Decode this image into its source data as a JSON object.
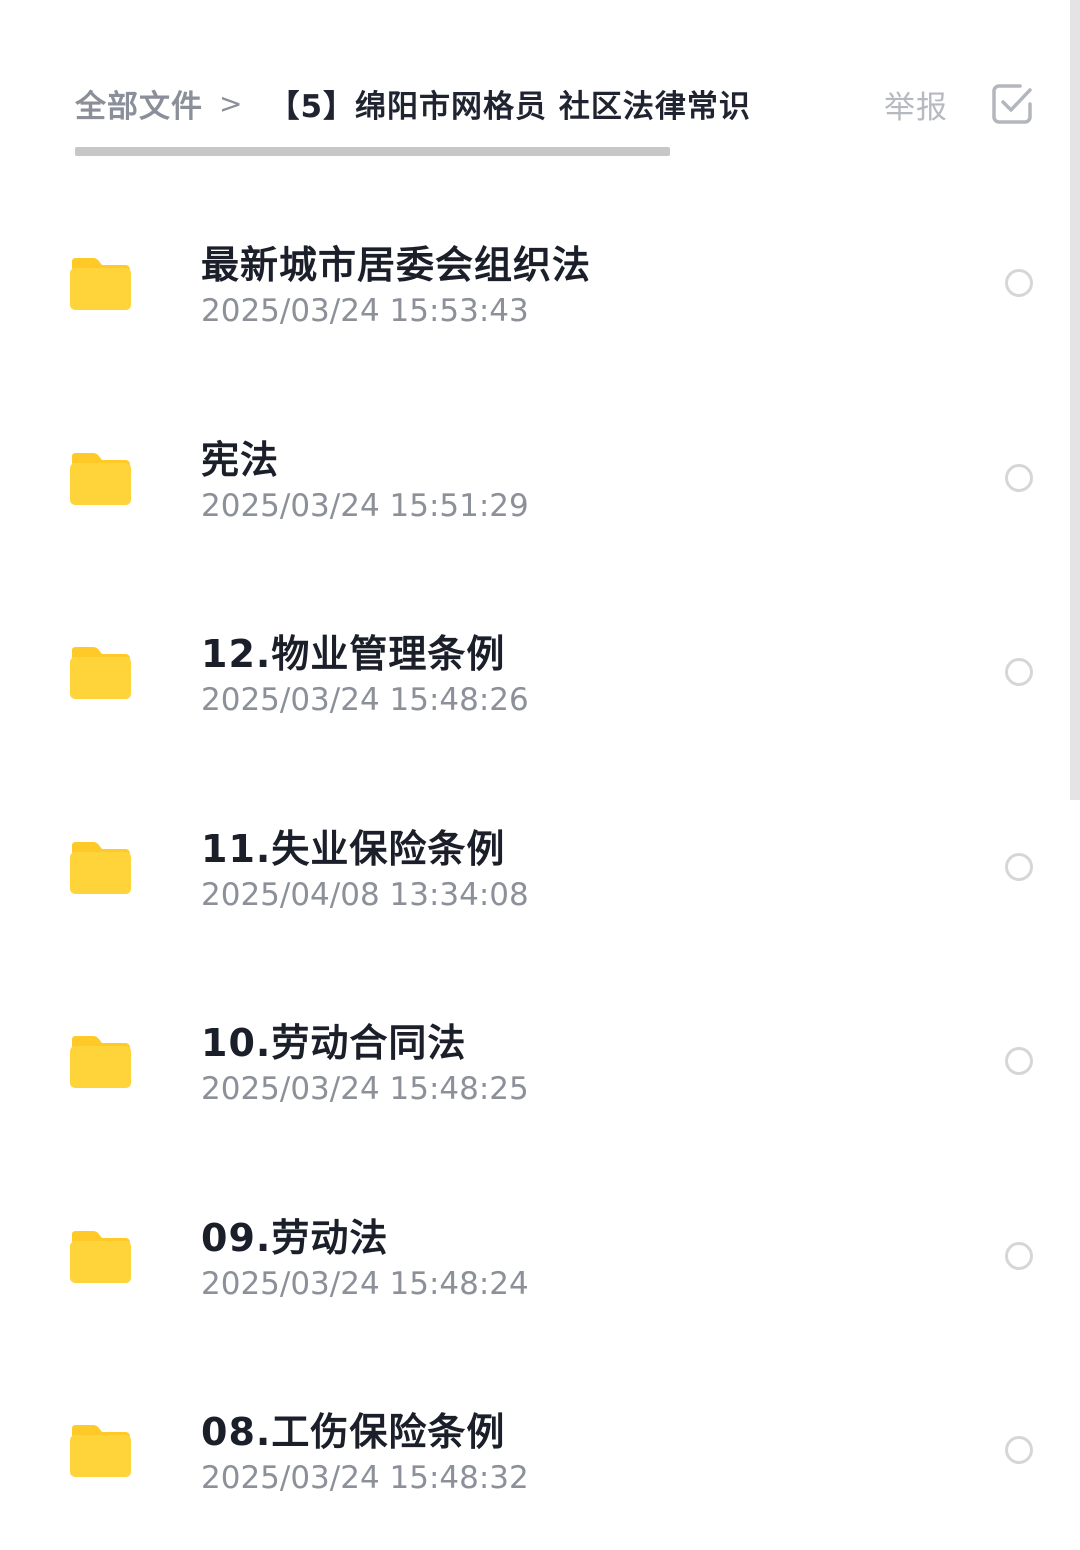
{
  "header": {
    "breadcrumb_root": "全部文件",
    "breadcrumb_separator": ">",
    "breadcrumb_current": "【5】绵阳市网格员 社区法律常识 （",
    "report_label": "举报",
    "select_icon": "checkbox-icon"
  },
  "colors": {
    "folder": "#FFD43B",
    "folder_tab": "#FFC928",
    "title": "#1B1F2A",
    "muted": "#8C9099"
  },
  "files": [
    {
      "name": "最新城市居委会组织法",
      "time": "2025/03/24 15:53:43",
      "icon": "folder-icon"
    },
    {
      "name": "宪法",
      "time": "2025/03/24 15:51:29",
      "icon": "folder-icon"
    },
    {
      "name": "12.物业管理条例",
      "time": "2025/03/24 15:48:26",
      "icon": "folder-icon"
    },
    {
      "name": "11.失业保险条例",
      "time": "2025/04/08 13:34:08",
      "icon": "folder-icon"
    },
    {
      "name": "10.劳动合同法",
      "time": "2025/03/24 15:48:25",
      "icon": "folder-icon"
    },
    {
      "name": "09.劳动法",
      "time": "2025/03/24 15:48:24",
      "icon": "folder-icon"
    },
    {
      "name": "08.工伤保险条例",
      "time": "2025/03/24 15:48:32",
      "icon": "folder-icon"
    }
  ]
}
